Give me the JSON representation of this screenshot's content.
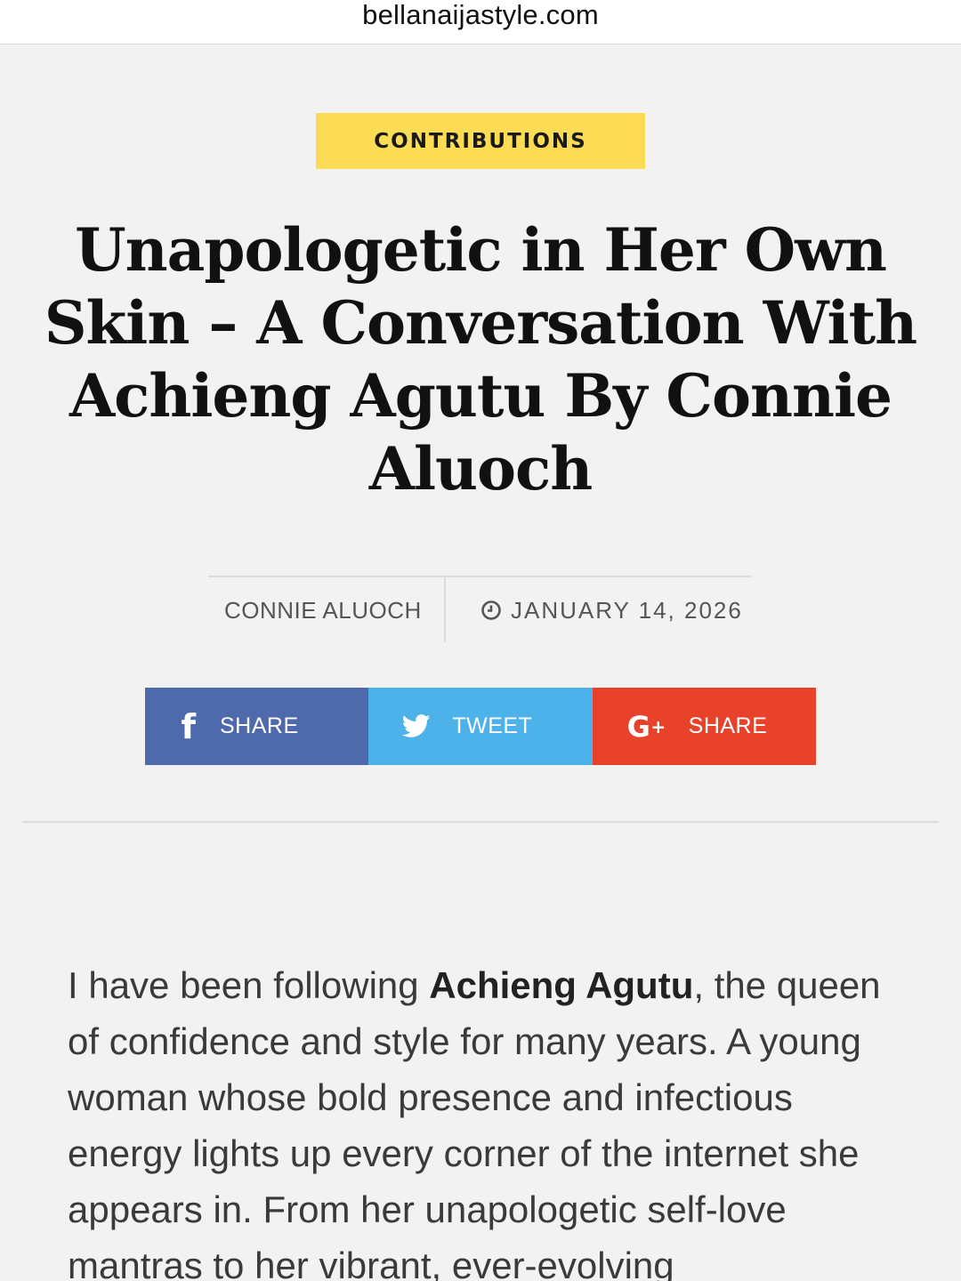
{
  "browser": {
    "url": "bellanaijastyle.com"
  },
  "article": {
    "category": "CONTRIBUTIONS",
    "title": "Unapologetic in Her Own Skin – A Conversation With Achieng Agutu By Connie Aluoch",
    "author": "CONNIE ALUOCH",
    "date": "JANUARY 14, 2026",
    "body": {
      "intro": "I have been following ",
      "highlight": "Achieng Agutu",
      "rest": ", the queen of confidence and style for many years. A young woman whose bold presence and infectious energy lights up every corner of the internet she appears in. From her unapologetic self-love mantras to her vibrant, ever-evolving"
    }
  },
  "share": {
    "facebook": {
      "label": "SHARE",
      "icon": "facebook-icon",
      "color": "#4e6aac"
    },
    "twitter": {
      "label": "TWEET",
      "icon": "twitter-bird-icon",
      "color": "#4db2ea"
    },
    "googleplus": {
      "label": "SHARE",
      "icon": "google-plus-icon",
      "color": "#e8432a"
    }
  },
  "colors": {
    "category_bg": "#fcdb55",
    "page_bg": "#f2f2f2"
  }
}
